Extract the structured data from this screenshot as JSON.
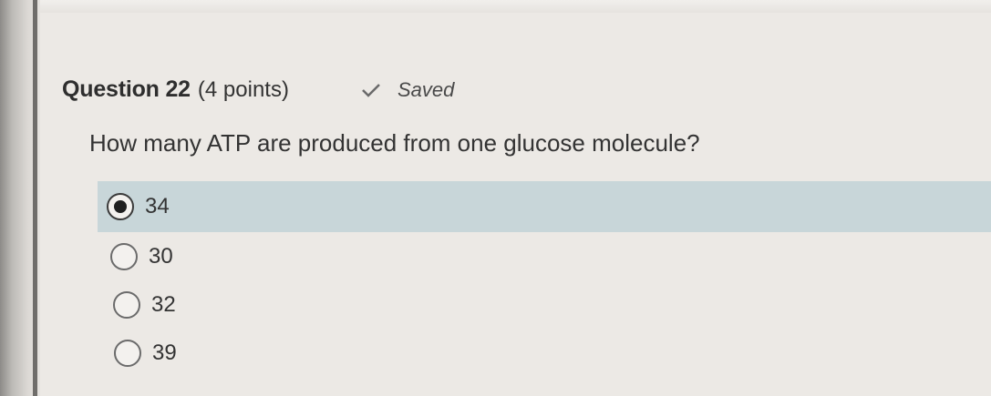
{
  "question": {
    "title": "Question 22",
    "points": "(4 points)",
    "status_icon": "check-icon",
    "status_text": "Saved",
    "prompt": "How many ATP are produced from one glucose molecule?"
  },
  "answers": [
    {
      "label": "34",
      "selected": true
    },
    {
      "label": "30",
      "selected": false
    },
    {
      "label": "32",
      "selected": false
    },
    {
      "label": "39",
      "selected": false
    }
  ],
  "colors": {
    "selected_row": "#c8d6d9",
    "text": "#333333"
  }
}
